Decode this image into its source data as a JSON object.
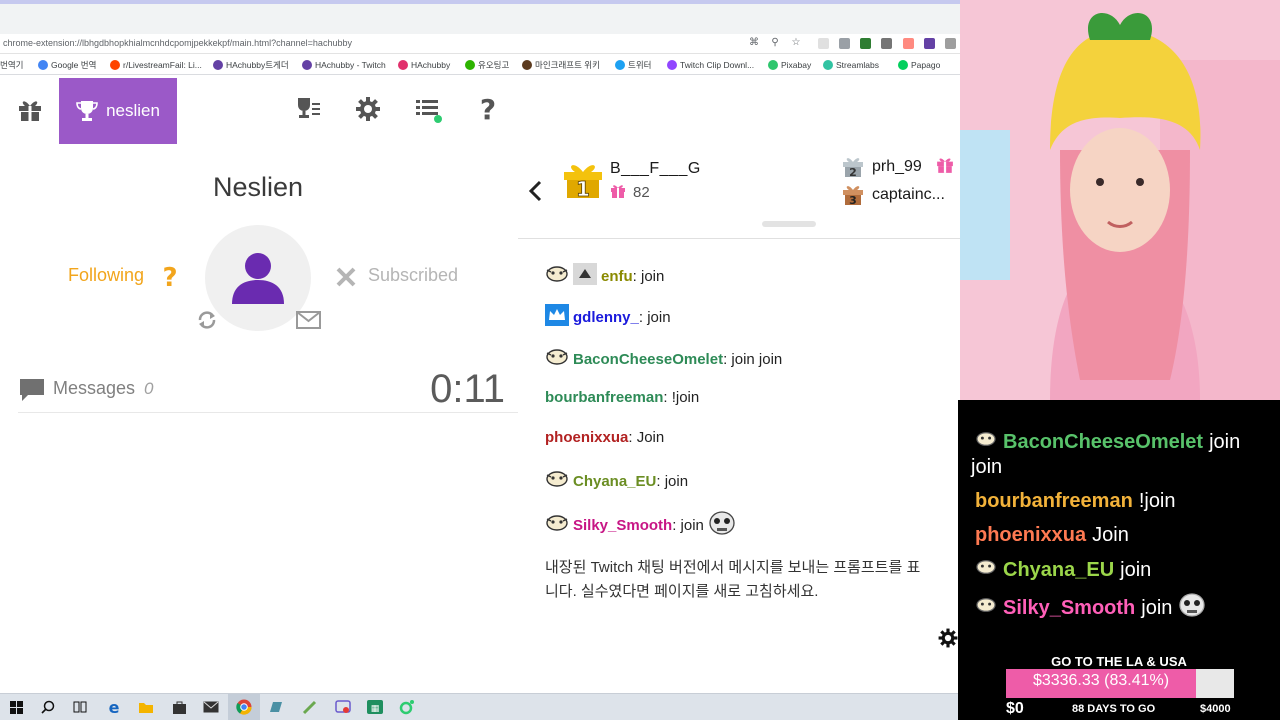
{
  "browser": {
    "url": "chrome-extension://lbhgdbhopkhialmcnhdcpomjpekkekpf/main.html?channel=hachubby",
    "bookmarks": [
      {
        "label": "번역기",
        "color": "#ffffff"
      },
      {
        "label": "Google 번역",
        "color": "#4285f4"
      },
      {
        "label": "r/LivestreamFail: Li...",
        "color": "#ff4500"
      },
      {
        "label": "HAchubby트게더",
        "color": "#6441a5"
      },
      {
        "label": "HAchubby - Twitch",
        "color": "#6441a5"
      },
      {
        "label": "HAchubby",
        "color": "#e1306c"
      },
      {
        "label": "유오팅고",
        "color": "#2db400"
      },
      {
        "label": "마인크래프트 위키",
        "color": "#5b3a1e"
      },
      {
        "label": "트위터",
        "color": "#1da1f2"
      },
      {
        "label": "Twitch Clip Downl...",
        "color": "#9146ff"
      },
      {
        "label": "Pixabay",
        "color": "#2ec66d"
      },
      {
        "label": "Streamlabs",
        "color": "#31c3a2"
      },
      {
        "label": "Papago",
        "color": "#03cf5d"
      }
    ]
  },
  "nav": {
    "profile_tab_label": "neslien"
  },
  "profile": {
    "title": "Neslien",
    "following_label": "Following",
    "subscribed_label": "Subscribed",
    "messages_label": "Messages",
    "messages_count": "0",
    "timer": "0:11"
  },
  "leaderboard": {
    "first": {
      "name": "B___F___G",
      "count": "82",
      "rank": "1"
    },
    "second": {
      "name": "prh_99",
      "rank": "2"
    },
    "third": {
      "name": "captainc...",
      "rank": "3"
    }
  },
  "chat": [
    {
      "user": "enfu",
      "color": "#8a8a00",
      "text": ": join",
      "badge": "face",
      "badge2": "triangle"
    },
    {
      "user": "gdlenny_",
      "color": "#1a1adc",
      "text": ": join",
      "badge": "crown"
    },
    {
      "user": "BaconCheeseOmelet",
      "color": "#2e8b57",
      "text": ": join join",
      "badge": "face"
    },
    {
      "user": "bourbanfreeman",
      "color": "#2e8b57",
      "text": ": !join",
      "badge": ""
    },
    {
      "user": "phoenixxua",
      "color": "#b22222",
      "text": ": Join",
      "badge": ""
    },
    {
      "user": "Chyana_EU",
      "color": "#6b8e23",
      "text": ": join",
      "badge": "face"
    },
    {
      "user": "Silky_Smooth",
      "color": "#c71585",
      "text": ": join",
      "badge": "face"
    }
  ],
  "notice_line1": "내장된 Twitch 채팅 버전에서 메시지를 보내는 프롬프트를 표",
  "notice_line2": "니다. 실수였다면 페이지를 새로 고침하세요.",
  "overlay": {
    "chat": [
      {
        "user": "BaconCheeseOmelet",
        "color": "#58c26a",
        "text": "join"
      },
      {
        "user": "",
        "color": "#ffffff",
        "text": "join"
      },
      {
        "user": "bourbanfreeman",
        "color": "#f2b23a",
        "text": "!join"
      },
      {
        "user": "phoenixxua",
        "color": "#ff7a52",
        "text": "Join"
      },
      {
        "user": "Chyana_EU",
        "color": "#9bd64a",
        "text": "join"
      },
      {
        "user": "Silky_Smooth",
        "color": "#ff5fb8",
        "text": "join"
      }
    ],
    "goal": {
      "title": "GO TO THE LA & USA",
      "progress_text": "$3336.33 (83.41%)",
      "progress": 0.8341,
      "min": "$0",
      "days": "88 DAYS TO GO",
      "max": "$4000"
    }
  },
  "colors": {
    "accent": "#9b59c8",
    "following": "#f2a51c"
  }
}
